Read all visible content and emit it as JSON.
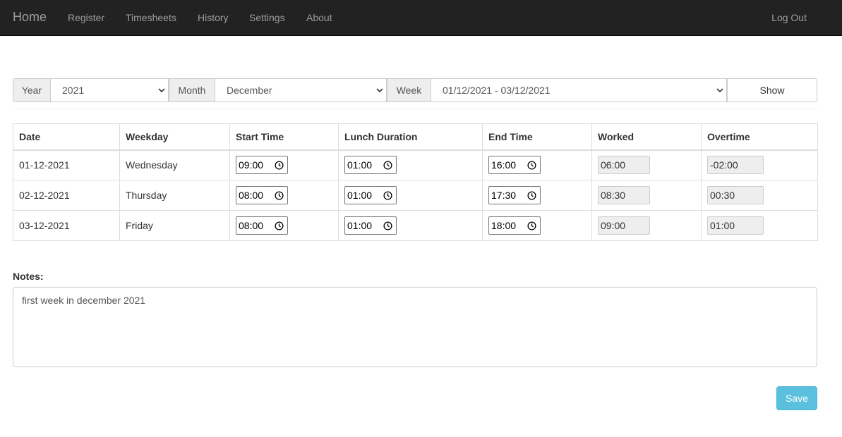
{
  "navbar": {
    "brand": "Home",
    "items": [
      "Register",
      "Timesheets",
      "History",
      "Settings",
      "About"
    ],
    "logout": "Log Out",
    "bg_color": "#222222",
    "text_color": "#9d9d9d"
  },
  "filters": {
    "year_label": "Year",
    "year_value": "2021",
    "month_label": "Month",
    "month_value": "December",
    "week_label": "Week",
    "week_value": "01/12/2021 - 03/12/2021",
    "show_label": "Show"
  },
  "table": {
    "headers": [
      "Date",
      "Weekday",
      "Start Time",
      "Lunch Duration",
      "End Time",
      "Worked",
      "Overtime"
    ],
    "rows": [
      {
        "date": "01-12-2021",
        "weekday": "Wednesday",
        "start": "09:00",
        "lunch": "01:00",
        "end": "16:00",
        "worked": "06:00",
        "overtime": "-02:00"
      },
      {
        "date": "02-12-2021",
        "weekday": "Thursday",
        "start": "08:00",
        "lunch": "01:00",
        "end": "17:30",
        "worked": "08:30",
        "overtime": "00:30"
      },
      {
        "date": "03-12-2021",
        "weekday": "Friday",
        "start": "08:00",
        "lunch": "01:00",
        "end": "18:00",
        "worked": "09:00",
        "overtime": "01:00"
      }
    ]
  },
  "notes": {
    "label": "Notes:",
    "value": "first week in december 2021"
  },
  "save_label": "Save",
  "colors": {
    "save_button": "#5bc0de",
    "readonly_bg": "#eeeeee"
  },
  "icons": {
    "select": "chevron-down-icon",
    "time": "clock-icon"
  }
}
